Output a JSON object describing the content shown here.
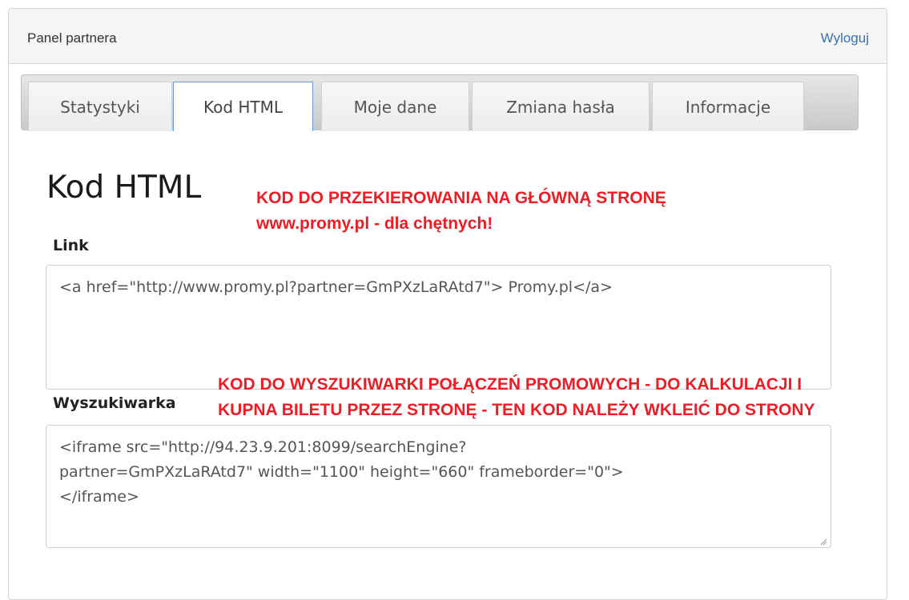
{
  "header": {
    "title": "Panel partnera",
    "logout_label": "Wyloguj"
  },
  "tabs": [
    {
      "label": "Statystyki",
      "active": false
    },
    {
      "label": "Kod HTML",
      "active": true
    },
    {
      "label": "Moje dane",
      "active": false
    },
    {
      "label": "Zmiana hasła",
      "active": false
    },
    {
      "label": "Informacje",
      "active": false
    }
  ],
  "main": {
    "heading": "Kod HTML",
    "note_top": {
      "line1": "KOD DO PRZEKIEROWANIA NA GŁÓWNĄ STRONĘ",
      "line2": "www.promy.pl - dla chętnych!"
    },
    "link": {
      "label": "Link",
      "value": "<a href=\"http://www.promy.pl?partner=GmPXzLaRAtd7\"> Promy.pl</a>"
    },
    "note_mid": {
      "line1": "KOD DO WYSZUKIWARKI POŁĄCZEŃ PROMOWYCH - DO KALKULACJI I",
      "line2": "KUPNA BILETU PRZEZ STRONĘ - TEN KOD NALEŻY WKLEIĆ DO STRONY"
    },
    "search": {
      "label": "Wyszukiwarka",
      "value": "<iframe src=\"http://94.23.9.201:8099/searchEngine?\npartner=GmPXzLaRAtd7\" width=\"1100\" height=\"660\" frameborder=\"0\">\n</iframe>"
    }
  },
  "colors": {
    "accent_link": "#3a72b5",
    "note_red": "#ee1c24",
    "active_tab_border": "#6b9bd6"
  }
}
